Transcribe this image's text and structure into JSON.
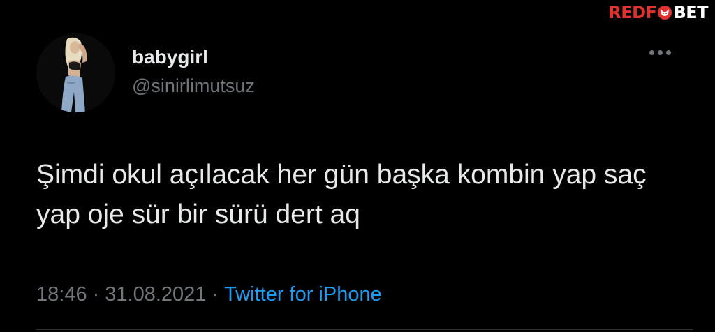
{
  "watermark": {
    "part1": "REDF",
    "part2": "X",
    "part3": "BET",
    "brand_red": "#e5312e"
  },
  "tweet": {
    "display_name": "babygirl",
    "handle": "@sinirlimutsuz",
    "text": "Şimdi okul açılacak her gün başka kombin yap saç yap oje sür bir sürü dert aq",
    "time": "18:46",
    "separator": "·",
    "date": "31.08.2021",
    "source": "Twitter for iPhone",
    "more_icon": "more-horizontal-icon"
  },
  "colors": {
    "background": "#000000",
    "primary_text": "#e7e9ea",
    "secondary_text": "#71767b",
    "link": "#1d9bf0"
  }
}
